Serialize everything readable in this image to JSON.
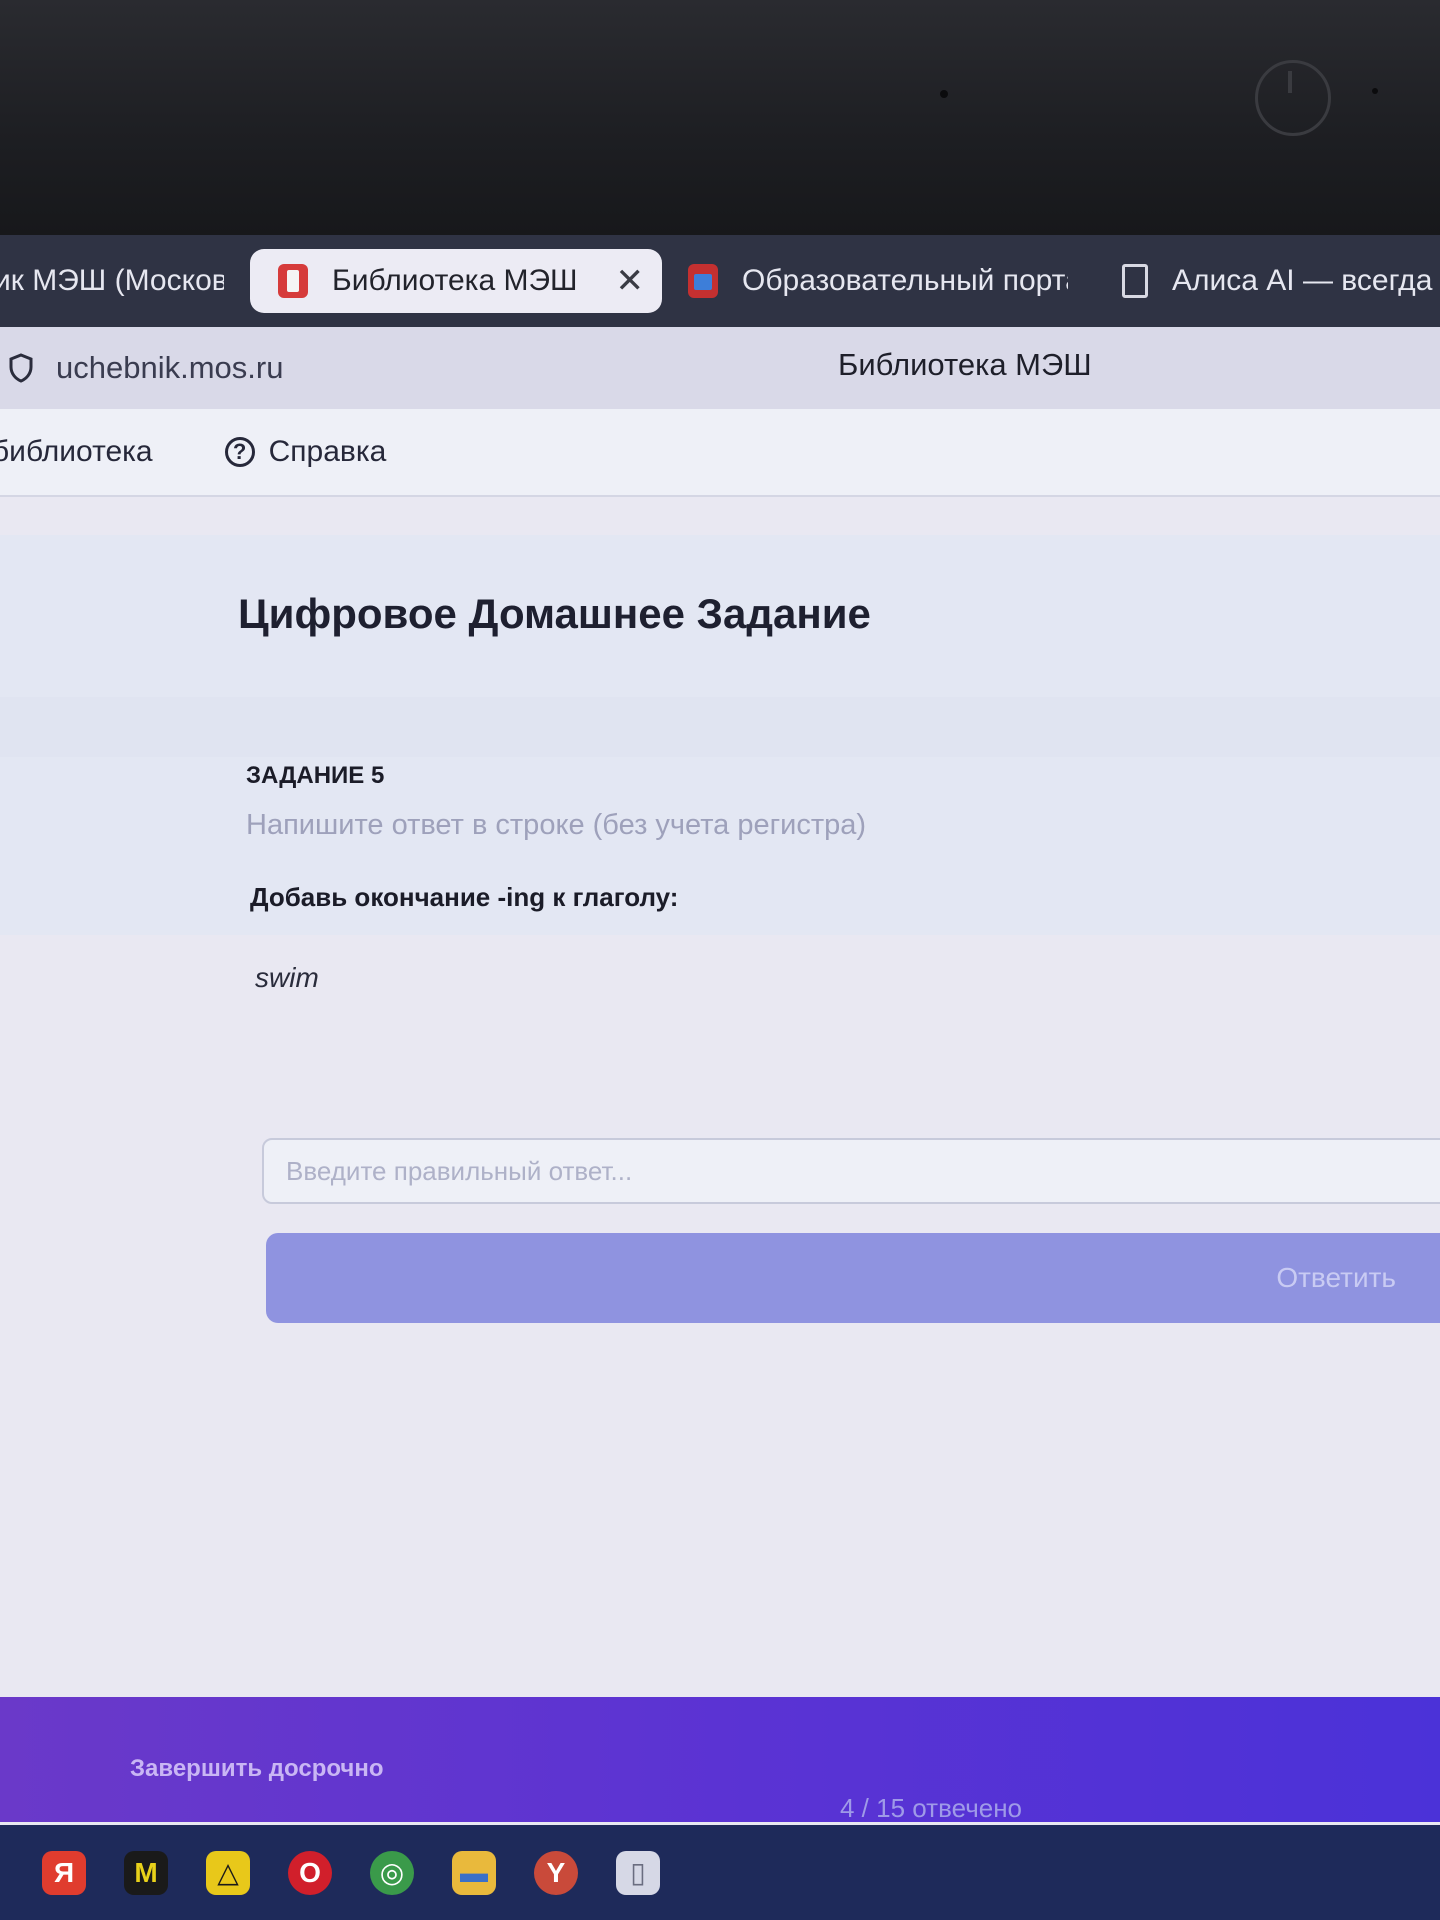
{
  "browser": {
    "tabs": [
      {
        "label": "ик МЭШ (Москов",
        "icon": "unknown-icon",
        "active": false
      },
      {
        "label": "Библиотека МЭШ",
        "icon": "mesh-library-icon",
        "active": true
      },
      {
        "label": "Образовательный порта",
        "icon": "portal-icon",
        "active": false
      },
      {
        "label": "Алиса AI — всегда п",
        "icon": "document-icon",
        "active": false
      }
    ],
    "url": "uchebnik.mos.ru",
    "page_title": "Библиотека МЭШ"
  },
  "site_nav": {
    "library": "библиотека",
    "help": "Справка",
    "help_icon_glyph": "?"
  },
  "main": {
    "title": "Цифровое Домашнее Задание",
    "task_label": "ЗАДАНИЕ 5",
    "instruction": "Напишите ответ в строке (без учета регистра)",
    "prompt": "Добавь окончание -ing к глаголу:",
    "word": "swim",
    "answer_placeholder": "Введите правильный ответ...",
    "submit_label": "Ответить"
  },
  "footer": {
    "finish_early": "Завершить досрочно",
    "answered": "4 / 15 отвечено"
  },
  "taskbar": {
    "apps": [
      {
        "name": "yandex-icon",
        "glyph": "Я",
        "color": "#e03c2e"
      },
      {
        "name": "app-logo-icon",
        "glyph": "M",
        "color": "#1a1a1a"
      },
      {
        "name": "warning-app-icon",
        "glyph": "△",
        "color": "#e8c81a"
      },
      {
        "name": "opera-icon",
        "glyph": "O",
        "color": "#d11f2b"
      },
      {
        "name": "chrome-icon",
        "glyph": "◎",
        "color": "#3a9a4a"
      },
      {
        "name": "folder-icon",
        "glyph": "▬",
        "color": "#e9b93c"
      },
      {
        "name": "yandex-browser-icon",
        "glyph": "Y",
        "color": "#c94a3a"
      },
      {
        "name": "file-icon",
        "glyph": "▯",
        "color": "#d6d8e6"
      }
    ]
  },
  "colors": {
    "accent": "#8f93e0",
    "footer": "#5b33d3",
    "tabbar": "#2f3344"
  }
}
